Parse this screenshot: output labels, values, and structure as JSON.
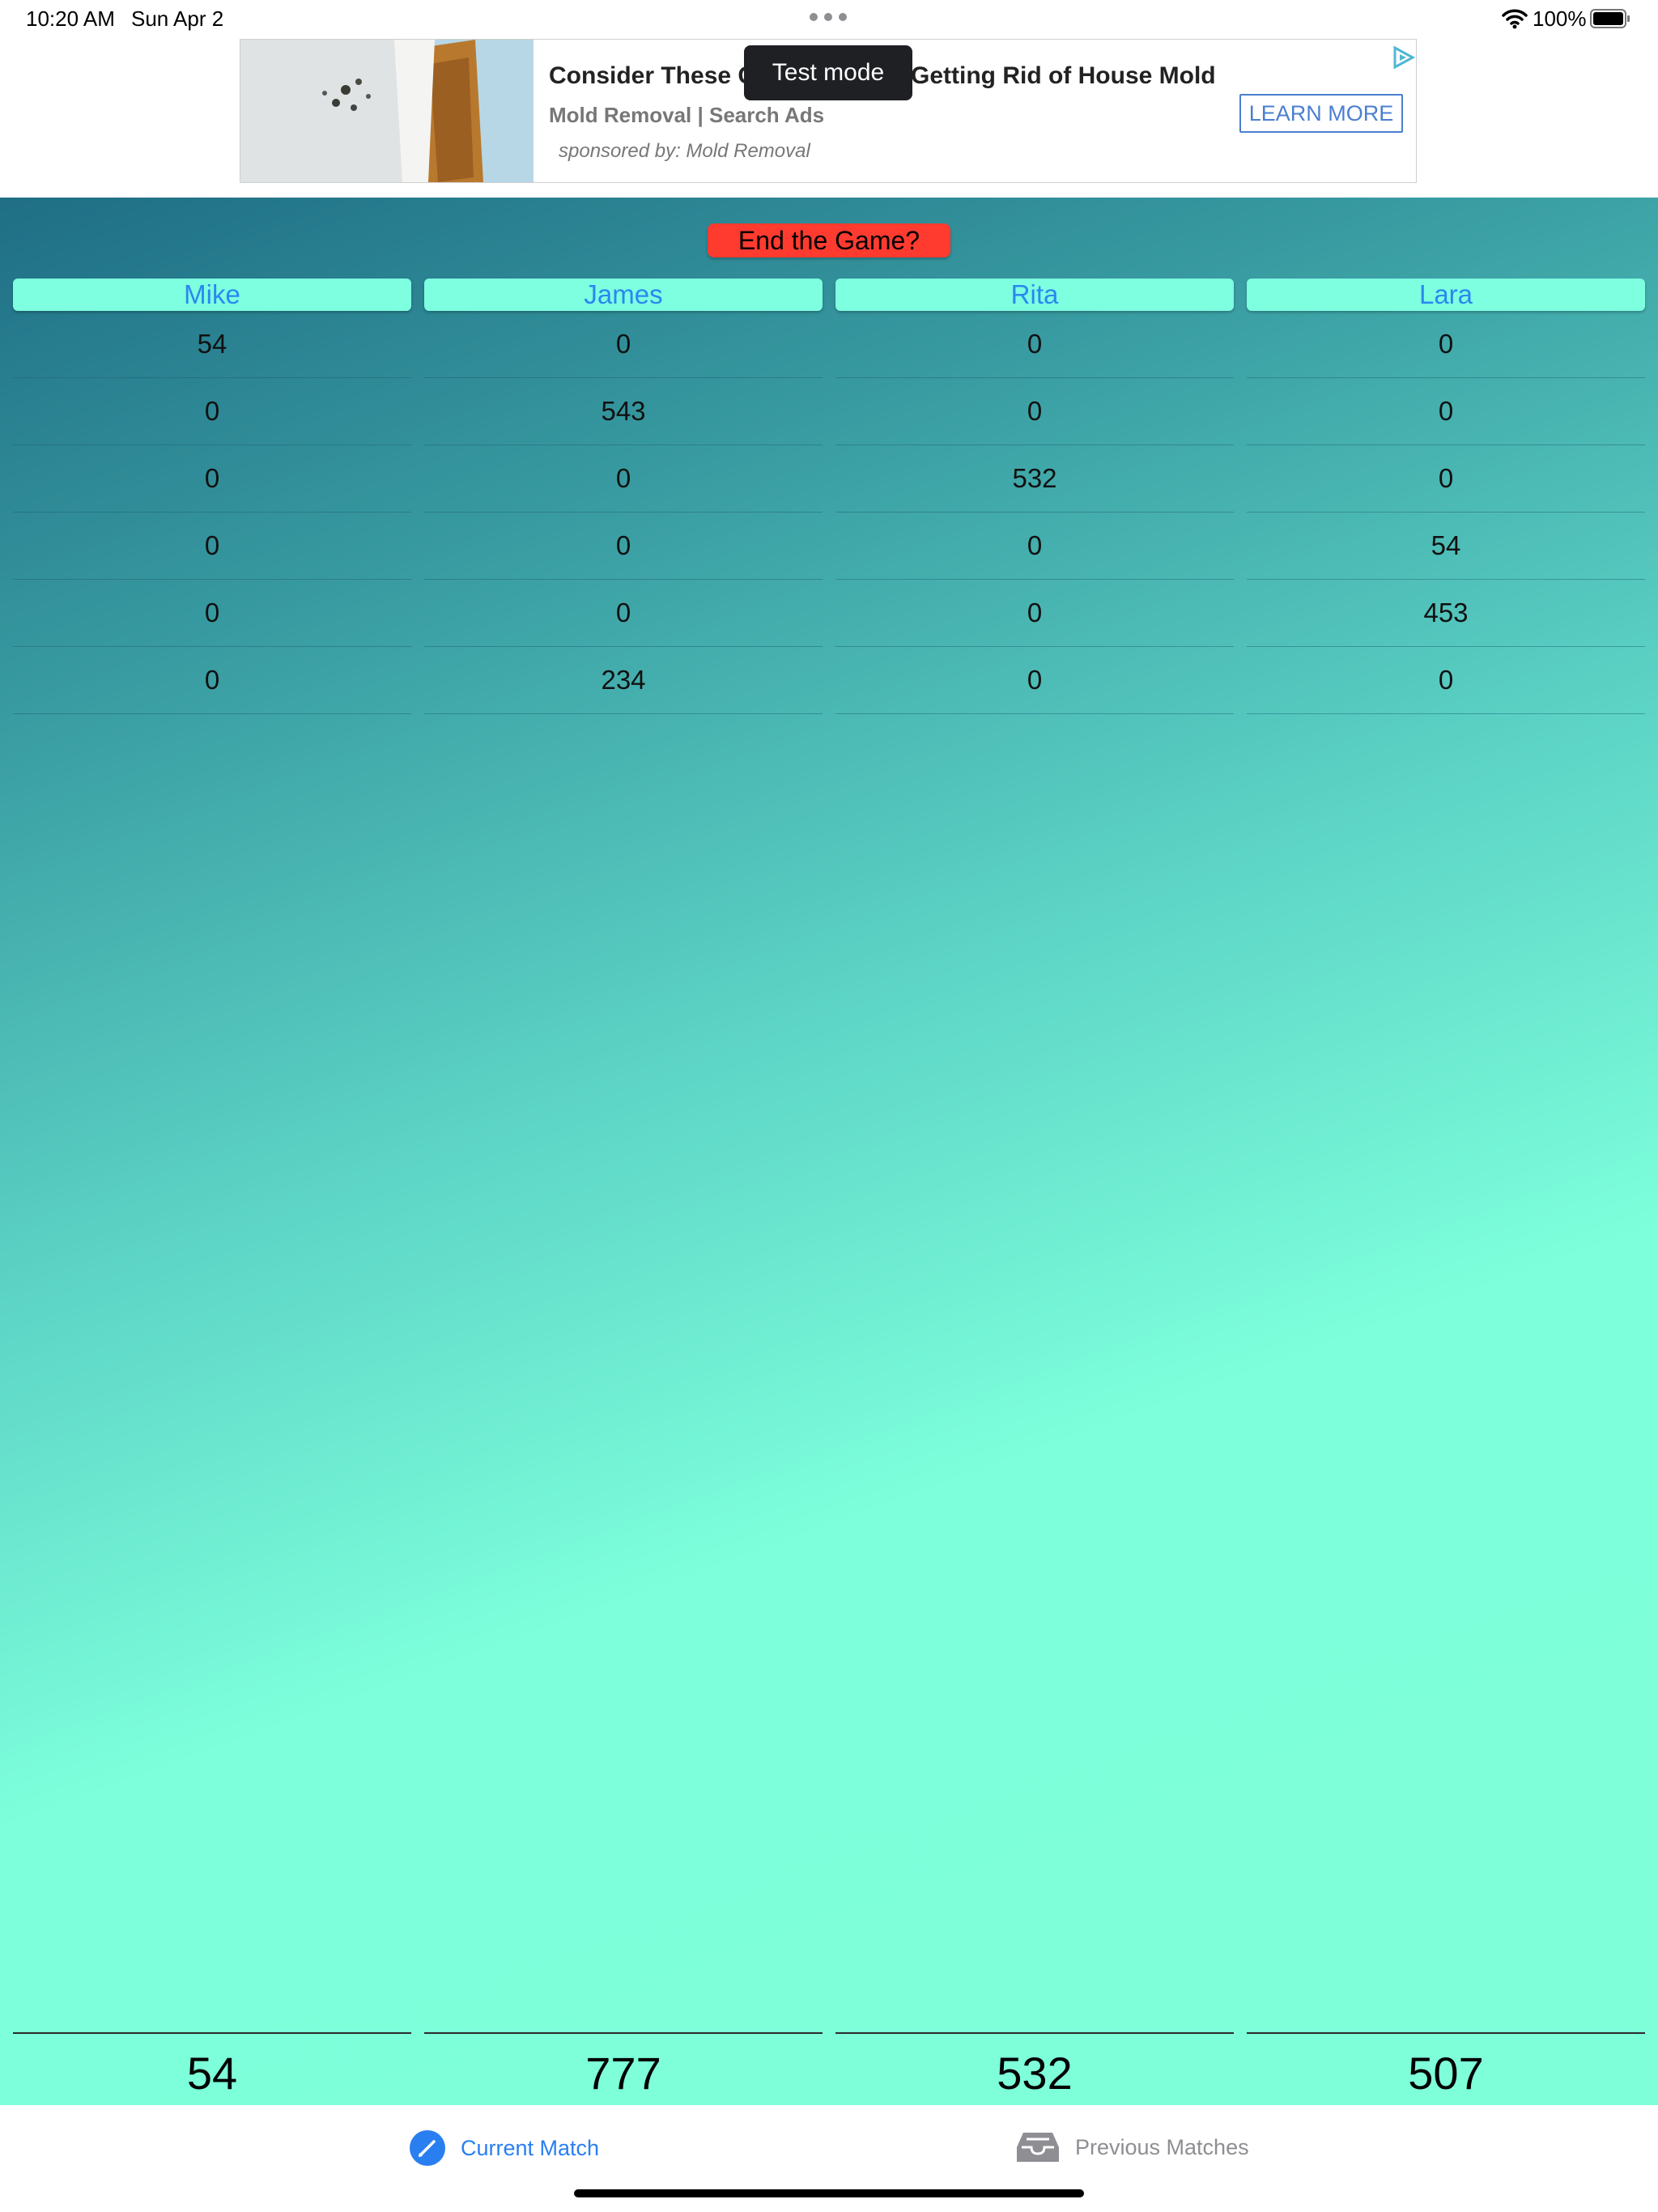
{
  "status_bar": {
    "time": "10:20 AM",
    "date": "Sun Apr 2",
    "battery": "100%"
  },
  "ad": {
    "headline_left": "Consider These C",
    "headline_right": "Getting Rid of House Mold",
    "subtitle": "Mold Removal | Search Ads",
    "sponsor": "sponsored by: Mold Removal",
    "cta": "LEARN MORE",
    "test_mode": "Test mode"
  },
  "game": {
    "end_button": "End the Game?",
    "players": [
      {
        "name": "Mike",
        "scores": [
          "54",
          "0",
          "0",
          "0",
          "0",
          "0"
        ],
        "total": "54"
      },
      {
        "name": "James",
        "scores": [
          "0",
          "543",
          "0",
          "0",
          "0",
          "234"
        ],
        "total": "777"
      },
      {
        "name": "Rita",
        "scores": [
          "0",
          "0",
          "532",
          "0",
          "0",
          "0"
        ],
        "total": "532"
      },
      {
        "name": "Lara",
        "scores": [
          "0",
          "0",
          "0",
          "54",
          "453",
          "0"
        ],
        "total": "507"
      }
    ]
  },
  "tabbar": {
    "current": {
      "label": "Current Match",
      "icon": "pencil-circle-icon",
      "color": "#2a7ff0"
    },
    "previous": {
      "label": "Previous Matches",
      "icon": "tray-icon",
      "color": "#8e8e93"
    }
  },
  "colors": {
    "accent": "#2a7ff0",
    "end_button": "#ff3b30",
    "header": "#7dffe0"
  }
}
